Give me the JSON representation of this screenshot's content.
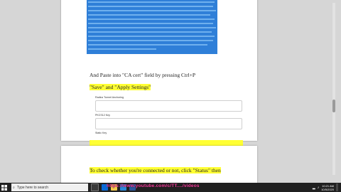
{
  "document": {
    "instruction1": "And Paste into \"CA cert\" field by pressing Ctrl+P",
    "instruction2": "\"Save\" and \"Apply Settings\"",
    "form": {
      "field1_label": "Radius Tunnel Anchoring",
      "field2_label": "PKCS12 Key",
      "field3_label": "Static Key"
    },
    "instruction3": "To check whether you're connected or not, click \"Status\" then"
  },
  "taskbar": {
    "search_placeholder": "Type here to search",
    "time": "10:21 AM",
    "date": "10/5/2020"
  },
  "overlay": {
    "url": "https://www.youtube.com/c/TT..../videos"
  },
  "colors": {
    "selection": "#2f7fd8",
    "highlight": "#ffff33",
    "taskbar": "#202020",
    "overlay_text": "#ff3fa3"
  }
}
